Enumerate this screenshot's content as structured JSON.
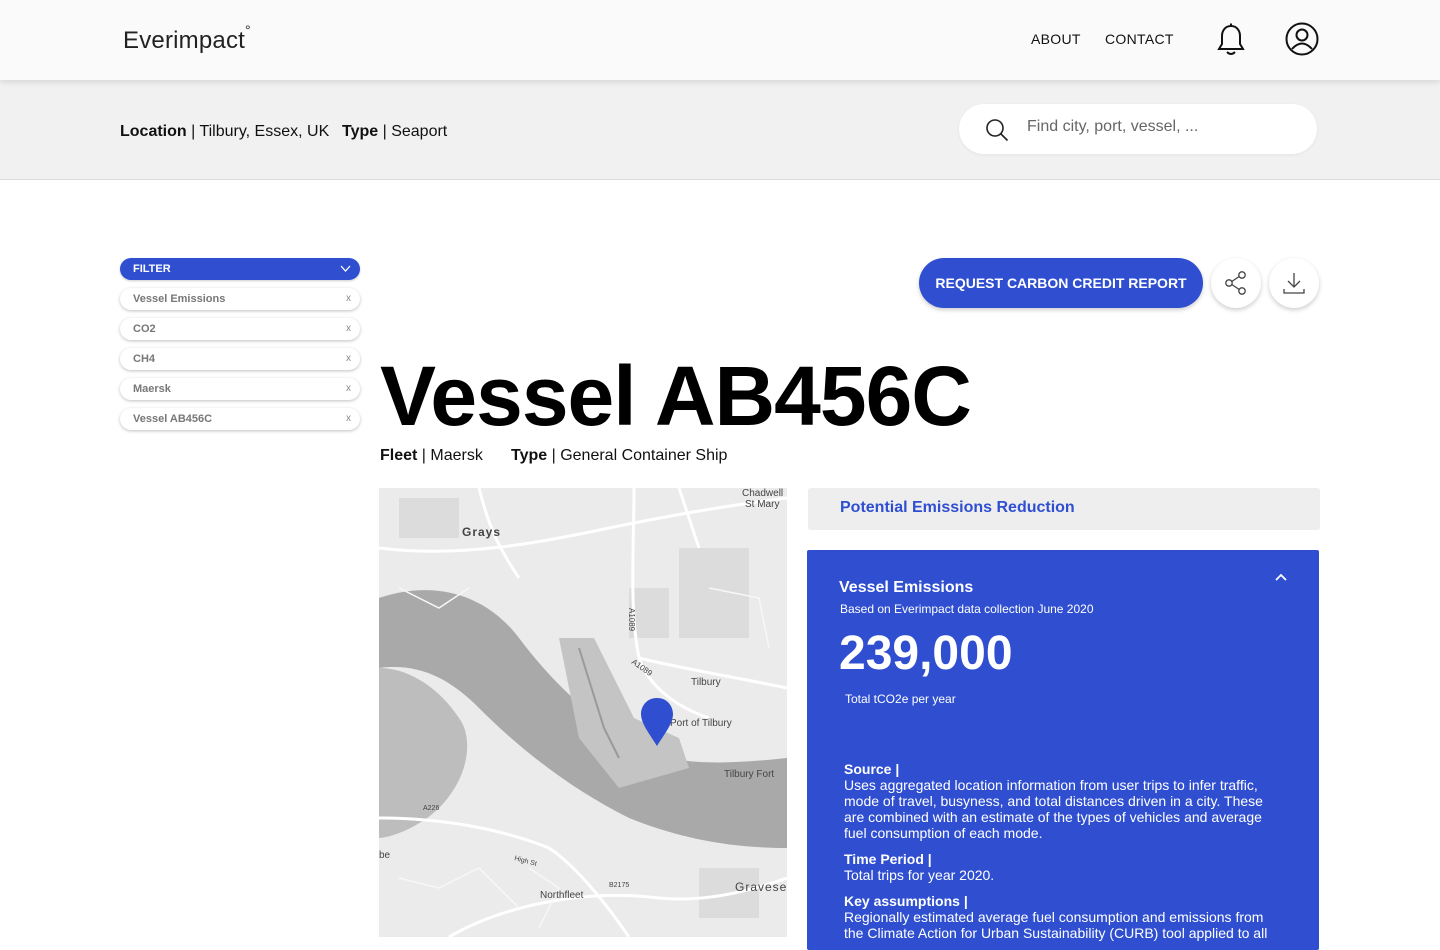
{
  "header": {
    "logo": "Everimpact",
    "logo_mark": "°",
    "nav": [
      "ABOUT",
      "CONTACT"
    ],
    "icons": [
      "bell-icon",
      "user-icon"
    ]
  },
  "context": {
    "location_label": "Location",
    "location_value": "Tilbury, Essex, UK",
    "type_label": "Type",
    "type_value": "Seaport",
    "search_placeholder": "Find city, port, vessel, ..."
  },
  "filter": {
    "label": "FILTER",
    "chips": [
      "Vessel Emissions",
      "CO2",
      "CH4",
      "Maersk",
      "Vessel AB456C"
    ],
    "remove_label": "x"
  },
  "actions": {
    "request_label": "REQUEST CARBON CREDIT REPORT"
  },
  "vessel": {
    "title": "Vessel AB456C",
    "fleet_label": "Fleet",
    "fleet_value": "Maersk",
    "type_label": "Type",
    "type_value": "General Container Ship"
  },
  "map": {
    "labels": {
      "chadwell": "Chadwell",
      "stmary": "St Mary",
      "grays": "Grays",
      "a1089a": "A1089",
      "a1089b": "A1089",
      "tilbury": "Tilbury",
      "port": "Port of Tilbury",
      "fort": "Tilbury Fort",
      "a226": "A226",
      "northfleet": "Northfleet",
      "gravesend": "Gravese",
      "be": "be",
      "b2175": "B2175",
      "highst": "High St"
    },
    "accent": "#2f4fd0"
  },
  "emissions": {
    "reduction_title": "Potential Emissions Reduction",
    "heading": "Vessel Emissions",
    "subheading": "Based on Everimpact data collection June 2020",
    "value": "239,000",
    "unit": "Total tCO2e per year",
    "source_label": "Source |",
    "source_text": "Uses aggregated location information from user trips to infer traffic, mode of travel, busyness, and total distances driven in a city. These are combined with an estimate of the types of vehicles and average fuel consumption of each mode.",
    "period_label": "Time Period |",
    "period_text": "Total trips for year 2020.",
    "assumptions_label": "Key assumptions |",
    "assumptions_text": "Regionally estimated average fuel consumption and emissions from the Climate Action for Urban Sustainability (CURB) tool applied to all"
  }
}
